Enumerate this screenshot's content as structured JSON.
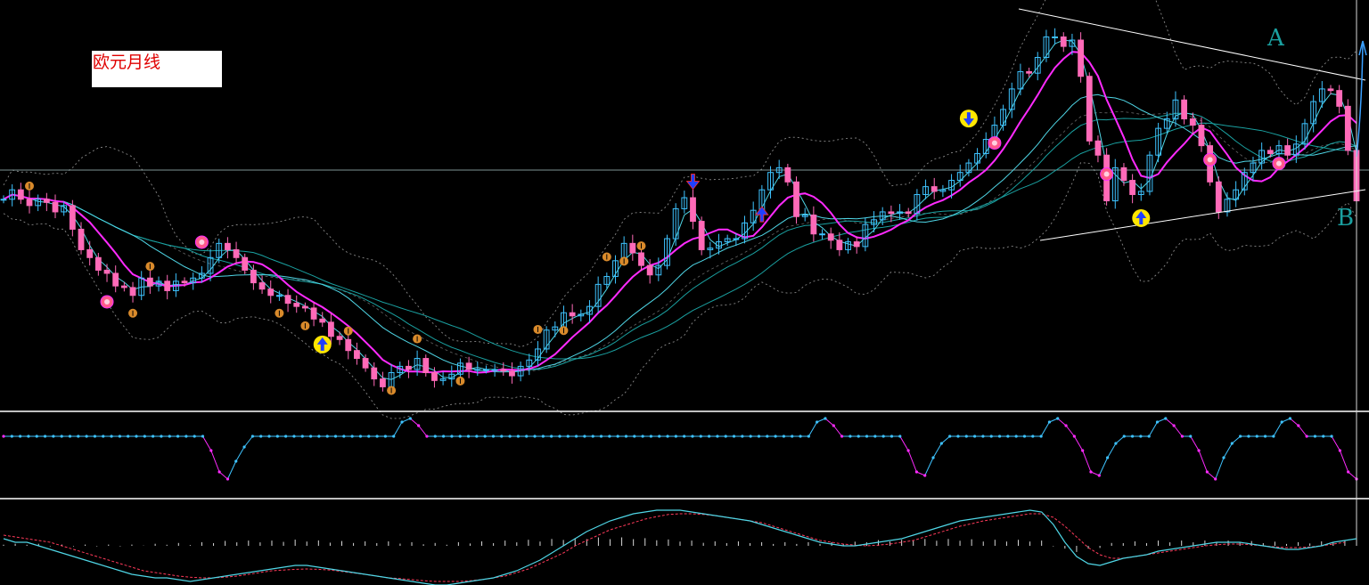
{
  "chart_title": "欧元月线",
  "labels": {
    "a": "A",
    "b": "B"
  },
  "colors": {
    "background": "#000000",
    "candle_up": "#3ec3ff",
    "candle_down": "#ff6ab8",
    "ma_magenta": "#ff2aff",
    "ma_cyan": "#4fd6e6",
    "ma_teal": "#1aa0a0",
    "bands": "#888888",
    "trendline": "#ffffff",
    "separator": "#ffffff"
  },
  "chart_data": [
    {
      "type": "line",
      "panel": "main",
      "title": "欧元月线",
      "series": [
        {
          "values": [
            7.3,
            7.9,
            7.3,
            6.9,
            7.3,
            7.1,
            6.5,
            6.9,
            5.4,
            4.1,
            3.6,
            2.8,
            2.6,
            1.8,
            1.7,
            1.2,
            2.3,
            1.8,
            2.1,
            1.5,
            2.1,
            2.0,
            2.3,
            2.6,
            3.6,
            4.5,
            4.1,
            3.6,
            2.8,
            2.0,
            1.6,
            1.2,
            1.2,
            0.7,
            0.5,
            0.4,
            -0.3,
            -0.5,
            -1.4,
            -1.6,
            -2.3,
            -2.8,
            -3.4,
            -4.1,
            -4.6,
            -3.7,
            -3.3,
            -3.5,
            -2.8,
            -3.7,
            -4.2,
            -4.1,
            -3.8,
            -3.1,
            -3.5,
            -3.5,
            -3.5,
            -3.5,
            -3.6,
            -3.9,
            -3.3,
            -2.9,
            -2.2,
            -1.0,
            -0.8,
            0.1,
            -0.1,
            0.0,
            0.5,
            1.9,
            2.4,
            3.4,
            4.5,
            3.9,
            3.1,
            2.5,
            3.1,
            4.8,
            6.7,
            7.4,
            5.9,
            4.1,
            4.2,
            4.6,
            4.8,
            4.8,
            5.8,
            6.6,
            7.9,
            9.0,
            9.3,
            8.4,
            6.2,
            6.3,
            5.1,
            5.1,
            4.7,
            4.1,
            4.6,
            4.3,
            5.7,
            6.0,
            6.5,
            6.4,
            6.5,
            6.4,
            7.6,
            8.1,
            7.8,
            7.9,
            8.5,
            9.0,
            9.6,
            10.2,
            11.1,
            12.0,
            13.0,
            14.3,
            15.4,
            15.3,
            16.3,
            17.6,
            17.6,
            17.0,
            17.4,
            15.1,
            11.0,
            10.1,
            7.2,
            9.3,
            8.5,
            7.6,
            7.8,
            10.1,
            11.8,
            12.4,
            13.6,
            12.4,
            12.0,
            10.7,
            8.4,
            6.5,
            7.3,
            7.9,
            9.0,
            9.6,
            10.4,
            10.2,
            10.7,
            10.1,
            10.8,
            12.1,
            13.5,
            14.3,
            14.2,
            13.2,
            10.4,
            7.2
          ]
        }
      ]
    },
    {
      "type": "line",
      "panel": "indicator",
      "series": [
        {
          "values": [
            0.5,
            0.5,
            0.5,
            0.5,
            0.5,
            0.5,
            0.5,
            0.5,
            0.5,
            0.5,
            0.5,
            0.5,
            0.5,
            0.5,
            0.5,
            0.5,
            0.5,
            0.5,
            0.5,
            0.5,
            0.5,
            0.5,
            0.5,
            0.5,
            0.5,
            0.1,
            -0.5,
            -0.7,
            -0.2,
            0.2,
            0.5,
            0.5,
            0.5,
            0.5,
            0.5,
            0.5,
            0.5,
            0.5,
            0.5,
            0.5,
            0.5,
            0.5,
            0.5,
            0.5,
            0.5,
            0.5,
            0.5,
            0.5,
            0.9,
            1.0,
            0.8,
            0.5,
            0.5,
            0.5,
            0.5,
            0.5,
            0.5,
            0.5,
            0.5,
            0.5,
            0.5,
            0.5,
            0.5,
            0.5,
            0.5,
            0.5,
            0.5,
            0.5,
            0.5,
            0.5,
            0.5,
            0.5,
            0.5,
            0.5,
            0.5,
            0.5,
            0.5,
            0.5,
            0.5,
            0.5,
            0.5,
            0.5,
            0.5,
            0.5,
            0.5,
            0.5,
            0.5,
            0.5,
            0.5,
            0.5,
            0.5,
            0.5,
            0.5,
            0.5,
            0.5,
            0.5,
            0.5,
            0.5,
            0.9,
            1.0,
            0.8,
            0.5,
            0.5,
            0.5,
            0.5,
            0.5,
            0.5,
            0.5,
            0.5,
            0.1,
            -0.5,
            -0.6,
            -0.1,
            0.3,
            0.5,
            0.5,
            0.5,
            0.5,
            0.5,
            0.5,
            0.5,
            0.5,
            0.5,
            0.5,
            0.5,
            0.5,
            0.9,
            1.0,
            0.8,
            0.5,
            0.1,
            -0.5,
            -0.6,
            -0.1,
            0.3,
            0.5,
            0.5,
            0.5,
            0.5,
            0.9,
            1.0,
            0.8,
            0.5,
            0.5,
            0.1,
            -0.5,
            -0.7,
            -0.1,
            0.3,
            0.5,
            0.5,
            0.5,
            0.5,
            0.5,
            0.9,
            1.0,
            0.8,
            0.5,
            0.5,
            0.5,
            0.5,
            0.1,
            -0.5,
            -0.7
          ]
        }
      ]
    },
    {
      "type": "line",
      "panel": "macd",
      "series": [
        {
          "values": [
            0.2,
            0.1,
            0.1,
            0.0,
            -0.1,
            -0.2,
            -0.3,
            -0.4,
            -0.5,
            -0.6,
            -0.7,
            -0.8,
            -0.85,
            -0.9,
            -0.9,
            -0.95,
            -1.0,
            -0.95,
            -0.9,
            -0.85,
            -0.8,
            -0.75,
            -0.7,
            -0.65,
            -0.6,
            -0.55,
            -0.55,
            -0.6,
            -0.65,
            -0.7,
            -0.75,
            -0.8,
            -0.85,
            -0.9,
            -0.95,
            -1.0,
            -1.05,
            -1.1,
            -1.1,
            -1.05,
            -1.0,
            -0.95,
            -0.9,
            -0.8,
            -0.7,
            -0.55,
            -0.4,
            -0.2,
            0.0,
            0.2,
            0.4,
            0.55,
            0.7,
            0.8,
            0.9,
            0.95,
            1.0,
            1.0,
            1.0,
            0.95,
            0.9,
            0.85,
            0.8,
            0.75,
            0.7,
            0.6,
            0.5,
            0.4,
            0.3,
            0.2,
            0.1,
            0.05,
            0.0,
            0.0,
            0.05,
            0.1,
            0.15,
            0.2,
            0.3,
            0.4,
            0.5,
            0.6,
            0.7,
            0.75,
            0.8,
            0.85,
            0.9,
            0.95,
            1.0,
            0.95,
            0.6,
            0.1,
            -0.3,
            -0.5,
            -0.55,
            -0.45,
            -0.35,
            -0.3,
            -0.25,
            -0.15,
            -0.1,
            -0.05,
            0.0,
            0.05,
            0.1,
            0.1,
            0.1,
            0.05,
            0.0,
            -0.05,
            -0.1,
            -0.1,
            -0.05,
            0.0,
            0.1,
            0.15,
            0.2
          ]
        },
        {
          "values": [
            0.3,
            0.25,
            0.2,
            0.15,
            0.1,
            0.0,
            -0.1,
            -0.2,
            -0.3,
            -0.4,
            -0.5,
            -0.6,
            -0.7,
            -0.75,
            -0.8,
            -0.85,
            -0.88,
            -0.9,
            -0.9,
            -0.88,
            -0.85,
            -0.8,
            -0.75,
            -0.7,
            -0.68,
            -0.66,
            -0.65,
            -0.66,
            -0.68,
            -0.72,
            -0.76,
            -0.8,
            -0.85,
            -0.9,
            -0.92,
            -0.95,
            -0.98,
            -1.0,
            -1.0,
            -1.0,
            -0.98,
            -0.95,
            -0.9,
            -0.85,
            -0.75,
            -0.65,
            -0.5,
            -0.35,
            -0.2,
            0.0,
            0.15,
            0.3,
            0.45,
            0.55,
            0.65,
            0.75,
            0.82,
            0.88,
            0.9,
            0.9,
            0.88,
            0.85,
            0.8,
            0.75,
            0.7,
            0.65,
            0.55,
            0.45,
            0.35,
            0.25,
            0.15,
            0.1,
            0.05,
            0.02,
            0.0,
            0.02,
            0.05,
            0.1,
            0.15,
            0.25,
            0.35,
            0.45,
            0.55,
            0.62,
            0.7,
            0.75,
            0.8,
            0.85,
            0.9,
            0.9,
            0.8,
            0.55,
            0.25,
            -0.05,
            -0.25,
            -0.35,
            -0.35,
            -0.3,
            -0.25,
            -0.2,
            -0.15,
            -0.1,
            -0.05,
            0.0,
            0.03,
            0.05,
            0.05,
            0.03,
            0.0,
            -0.03,
            -0.05,
            -0.05,
            -0.03,
            0.0,
            0.05,
            0.1
          ]
        }
      ]
    }
  ]
}
